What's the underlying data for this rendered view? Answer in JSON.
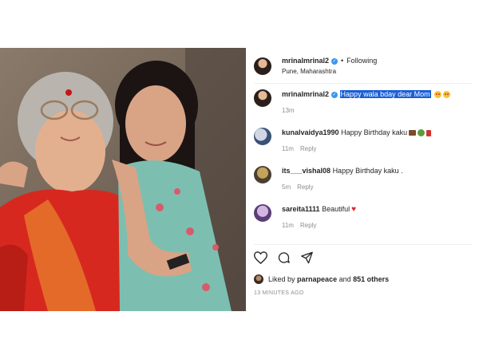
{
  "post": {
    "author": {
      "username": "mrinalmrinal2",
      "following_label": "Following",
      "location": "Pune, Maharashtra"
    },
    "caption": {
      "username": "mrinalmrinal2",
      "text": "Happy wala bday dear Mom",
      "time": "13m",
      "emojis": [
        "smiling-face-with-hearts",
        "smiling-face-with-hearts"
      ]
    },
    "comments": [
      {
        "username": "kunalvaidya1990",
        "text": "Happy Birthday kaku",
        "emojis": [
          "cake",
          "bouquet",
          "gift"
        ],
        "time": "11m",
        "reply": "Reply"
      },
      {
        "username": "its___vishal08",
        "text": "Happy Birthday kaku .",
        "emojis": [],
        "time": "5m",
        "reply": "Reply"
      },
      {
        "username": "sareita1111",
        "text": "Beautiful",
        "emojis": [
          "red-heart"
        ],
        "time": "11m",
        "reply": "Reply"
      }
    ],
    "likes": {
      "prefix": "Liked by",
      "user": "parnapeace",
      "connector": "and",
      "others": "851 others"
    },
    "timestamp": "13 MINUTES AGO",
    "colors": {
      "verified_badge": "#3897f0",
      "caption_highlight": "#1a5fd8",
      "meta_gray": "#8e8e8e",
      "heart_red": "#e0242e"
    },
    "icons": [
      "like-heart-icon",
      "comment-icon",
      "share-icon"
    ]
  }
}
